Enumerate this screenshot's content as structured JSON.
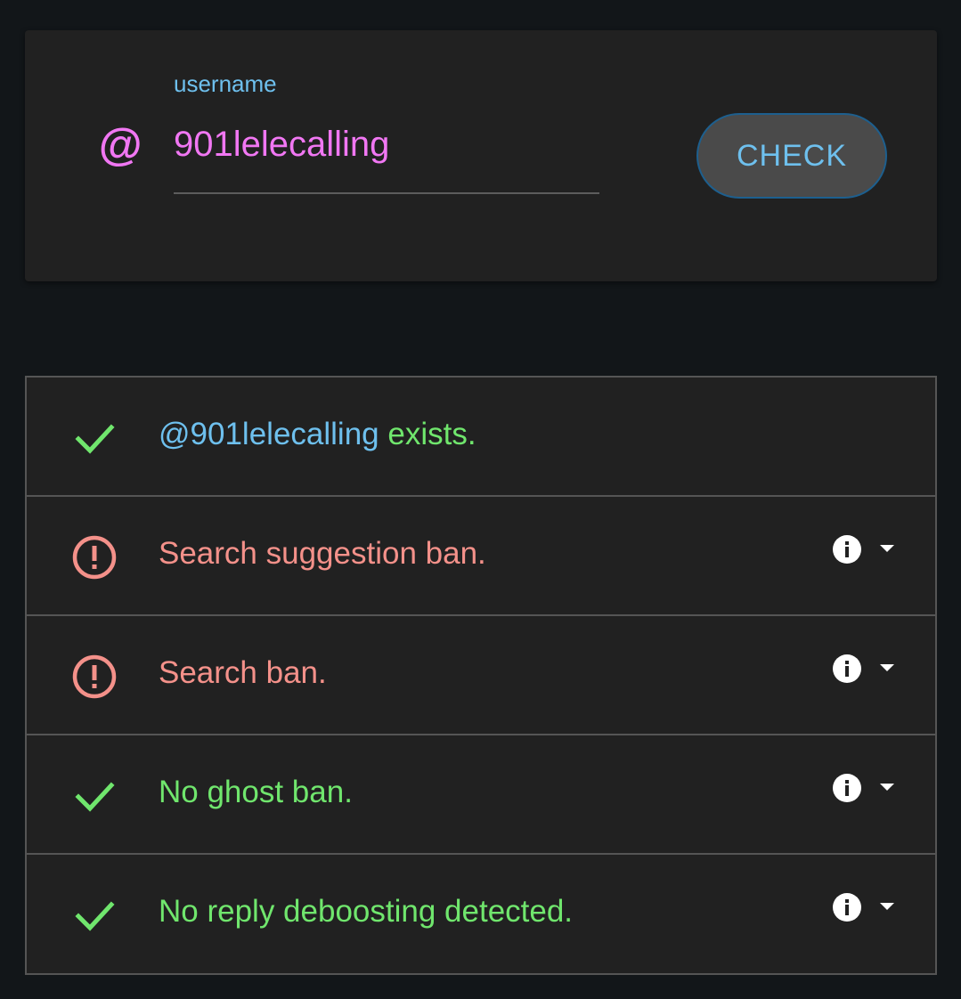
{
  "form": {
    "at_symbol": "@",
    "field_label": "username",
    "username_value": "901lelecalling",
    "check_label": "CHECK"
  },
  "colors": {
    "background": "#121619",
    "card": "#212121",
    "accent_pink": "#f177f3",
    "accent_blue": "#6ec0ee",
    "ok_green": "#70e66d",
    "warn_red": "#f4918a"
  },
  "results": [
    {
      "status": "ok",
      "icon": "check-icon",
      "handle": "@901lelecalling",
      "text": " exists.",
      "has_details": false
    },
    {
      "status": "ban",
      "icon": "alert-circle-icon",
      "text": "Search suggestion ban.",
      "has_details": true
    },
    {
      "status": "ban",
      "icon": "alert-circle-icon",
      "text": "Search ban.",
      "has_details": true
    },
    {
      "status": "ok",
      "icon": "check-icon",
      "text": "No ghost ban.",
      "has_details": true
    },
    {
      "status": "ok",
      "icon": "check-icon",
      "text": "No reply deboosting detected.",
      "has_details": true
    }
  ]
}
